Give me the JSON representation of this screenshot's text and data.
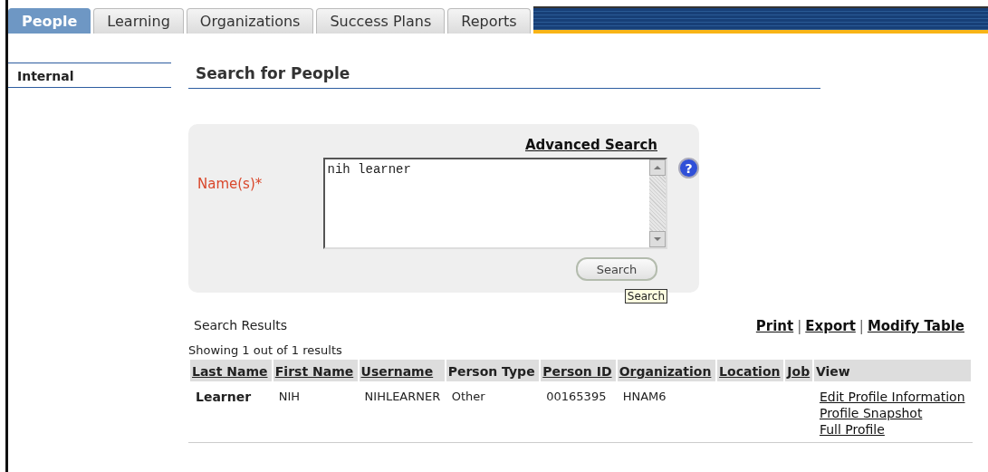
{
  "tabs": [
    {
      "label": "People",
      "selected": true
    },
    {
      "label": "Learning",
      "selected": false
    },
    {
      "label": "Organizations",
      "selected": false
    },
    {
      "label": "Success Plans",
      "selected": false
    },
    {
      "label": "Reports",
      "selected": false
    }
  ],
  "sidebar": {
    "items": [
      {
        "label": "Internal"
      }
    ]
  },
  "page_title": "Search for People",
  "search_panel": {
    "advanced_link": "Advanced Search",
    "name_label": "Name(s)*",
    "name_value": "nih learner",
    "search_button": "Search",
    "tooltip": "Search",
    "help": "?"
  },
  "results": {
    "title": "Search Results",
    "actions": [
      "Print",
      "Export",
      "Modify Table"
    ],
    "separators": [
      "|",
      "|"
    ],
    "summary": "Showing 1 out of 1 results",
    "columns": [
      {
        "label": "Last Name",
        "sortable": true
      },
      {
        "label": "First Name",
        "sortable": true
      },
      {
        "label": "Username",
        "sortable": true
      },
      {
        "label": "Person Type",
        "sortable": false
      },
      {
        "label": "Person ID",
        "sortable": true
      },
      {
        "label": "Organization",
        "sortable": true
      },
      {
        "label": "Location",
        "sortable": true
      },
      {
        "label": "Job",
        "sortable": true
      },
      {
        "label": "View",
        "sortable": false
      }
    ],
    "rows": [
      {
        "last_name": "Learner",
        "first_name": "NIH",
        "username": "NIHLEARNER",
        "person_type": "Other",
        "person_id": "00165395",
        "organization": "HNAM6",
        "view_links": [
          "Edit Profile Information",
          "Profile Snapshot",
          "Full Profile"
        ]
      }
    ]
  }
}
